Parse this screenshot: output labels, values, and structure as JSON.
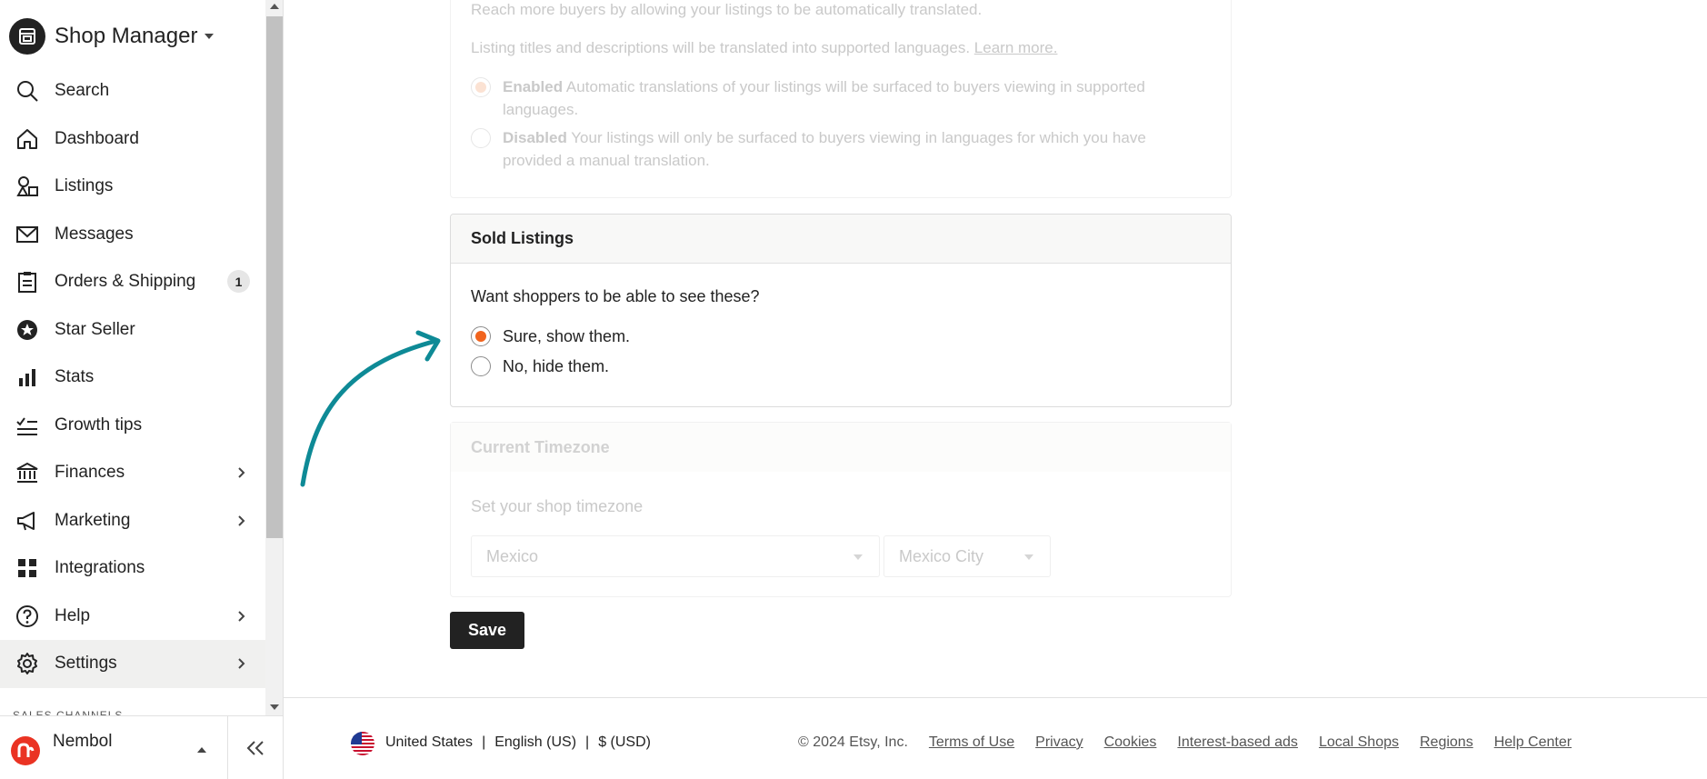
{
  "brand": {
    "title": "Shop Manager"
  },
  "nav": {
    "items": [
      {
        "key": "search",
        "label": "Search"
      },
      {
        "key": "dashboard",
        "label": "Dashboard"
      },
      {
        "key": "listings",
        "label": "Listings"
      },
      {
        "key": "messages",
        "label": "Messages"
      },
      {
        "key": "orders",
        "label": "Orders & Shipping",
        "badge": "1"
      },
      {
        "key": "star-seller",
        "label": "Star Seller"
      },
      {
        "key": "stats",
        "label": "Stats"
      },
      {
        "key": "growth",
        "label": "Growth tips"
      },
      {
        "key": "finances",
        "label": "Finances"
      },
      {
        "key": "marketing",
        "label": "Marketing"
      },
      {
        "key": "integrations",
        "label": "Integrations"
      },
      {
        "key": "help",
        "label": "Help"
      },
      {
        "key": "settings",
        "label": "Settings",
        "active": true
      }
    ],
    "section_label": "SALES CHANNELS"
  },
  "shop": {
    "name": "Nembol"
  },
  "translation": {
    "intro": "Reach more buyers by allowing your listings to be automatically translated.",
    "note": "Listing titles and descriptions will be translated into supported languages.",
    "learn_more": "Learn more.",
    "enabled_title": "Enabled",
    "enabled_text": "Automatic translations of your listings will be surfaced to buyers viewing in supported languages.",
    "disabled_title": "Disabled",
    "disabled_text": "Your listings will only be surfaced to buyers viewing in languages for which you have provided a manual translation."
  },
  "sold_listings": {
    "title": "Sold Listings",
    "question": "Want shoppers to be able to see these?",
    "option_show": "Sure, show them.",
    "option_hide": "No, hide them.",
    "selected": "show"
  },
  "timezone": {
    "title": "Current Timezone",
    "label": "Set your shop timezone",
    "country": "Mexico",
    "city": "Mexico City"
  },
  "actions": {
    "save_label": "Save"
  },
  "footer": {
    "country": "United States",
    "language": "English (US)",
    "currency": "$ (USD)",
    "separator": "|",
    "copyright": "© 2024 Etsy, Inc.",
    "links": [
      "Terms of Use",
      "Privacy",
      "Cookies",
      "Interest-based ads",
      "Local Shops",
      "Regions",
      "Help Center"
    ]
  },
  "colors": {
    "accent": "#f1641e",
    "arrow": "#0e8a96",
    "dark": "#222222"
  }
}
